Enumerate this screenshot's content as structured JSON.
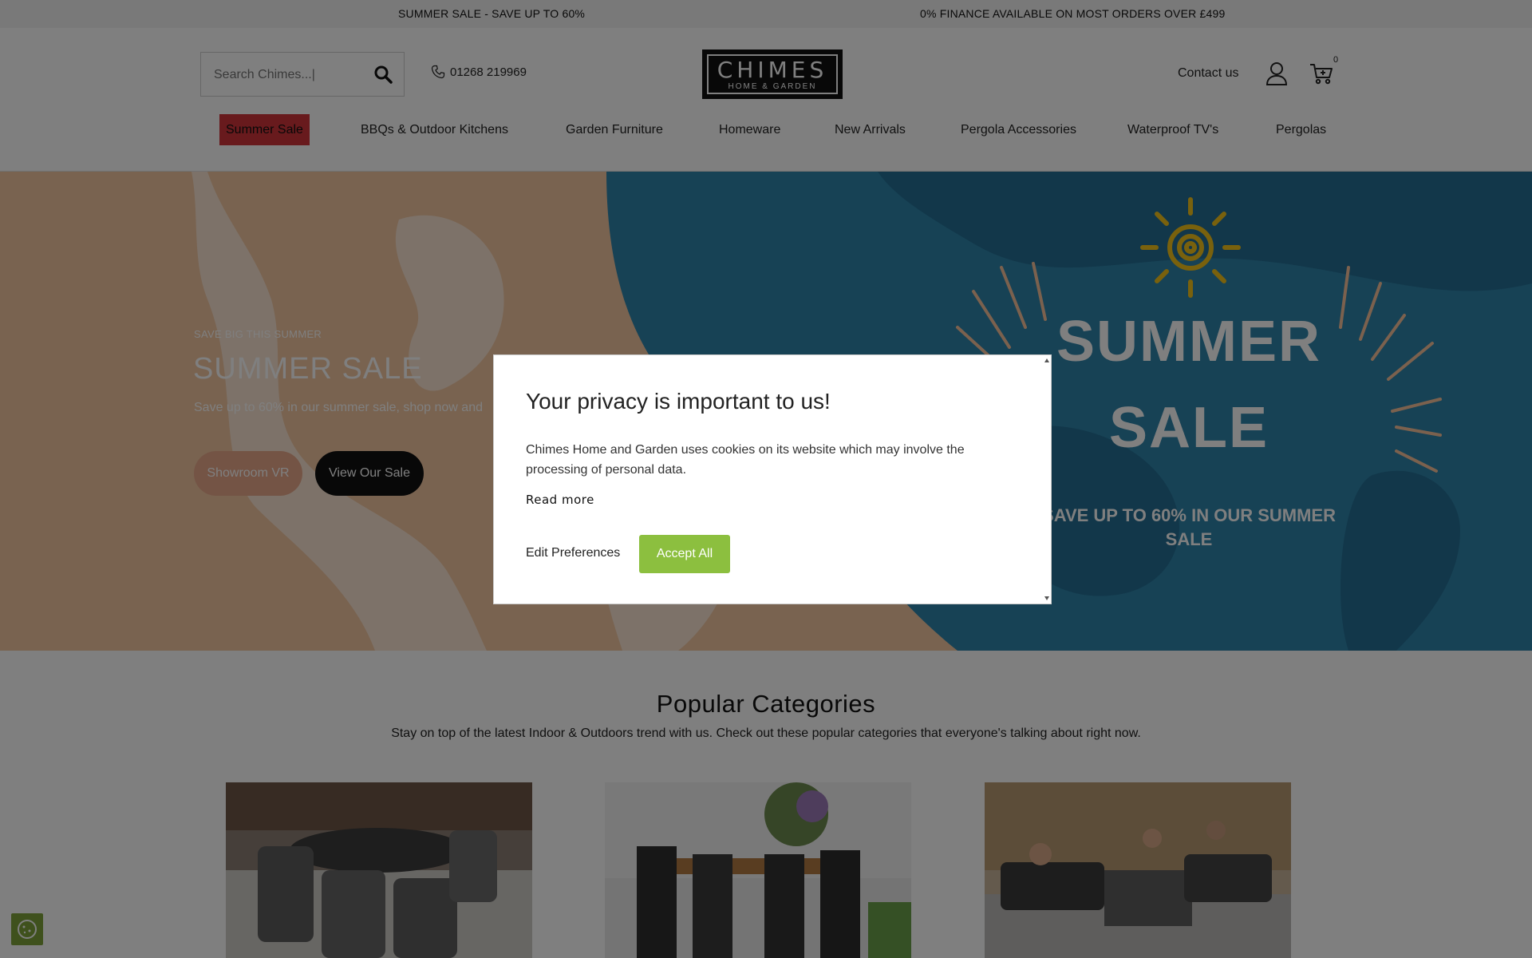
{
  "promo_bar": {
    "left_text": "SUMMER SALE - SAVE UP TO 60%",
    "right_text": "0% FINANCE AVAILABLE ON MOST ORDERS OVER £499"
  },
  "header": {
    "search_placeholder": "Search Chimes...|",
    "phone": "01268 219969",
    "logo_top": "CHIMES",
    "logo_bottom": "HOME & GARDEN",
    "contact": "Contact us",
    "cart_count": "0"
  },
  "nav": {
    "items": [
      {
        "label": "Summer Sale"
      },
      {
        "label": "BBQs & Outdoor Kitchens"
      },
      {
        "label": "Garden Furniture"
      },
      {
        "label": "Homeware"
      },
      {
        "label": "New Arrivals"
      },
      {
        "label": "Pergola Accessories"
      },
      {
        "label": "Waterproof TV's"
      },
      {
        "label": "Pergolas"
      }
    ]
  },
  "hero": {
    "eyebrow": "SAVE BIG THIS SUMMER",
    "title": "SUMMER SALE",
    "subtitle": "Save up to 60% in our summer sale, shop now and",
    "button_vr": "Showroom VR",
    "button_sale": "View Our Sale",
    "big_line1": "SUMMER",
    "big_line2": "SALE",
    "save_text": "SAVE UP TO 60% IN OUR SUMMER SALE"
  },
  "categories": {
    "title": "Popular Categories",
    "subtitle": "Stay on top of the latest Indoor & Outdoors trend with us. Check out these popular categories that everyone's talking about right now."
  },
  "modal": {
    "title": "Your privacy is important to us!",
    "body": "Chimes Home and Garden uses cookies on its website which may involve the processing of personal data.",
    "read_more": "Read more",
    "edit_preferences": "Edit Preferences",
    "accept_all": "Accept All"
  },
  "colors": {
    "sale_red": "#d0343a",
    "accept_green": "#8cbf3f",
    "hero_peach": "#f4c9a2",
    "hero_blue": "#2a7fa6"
  }
}
